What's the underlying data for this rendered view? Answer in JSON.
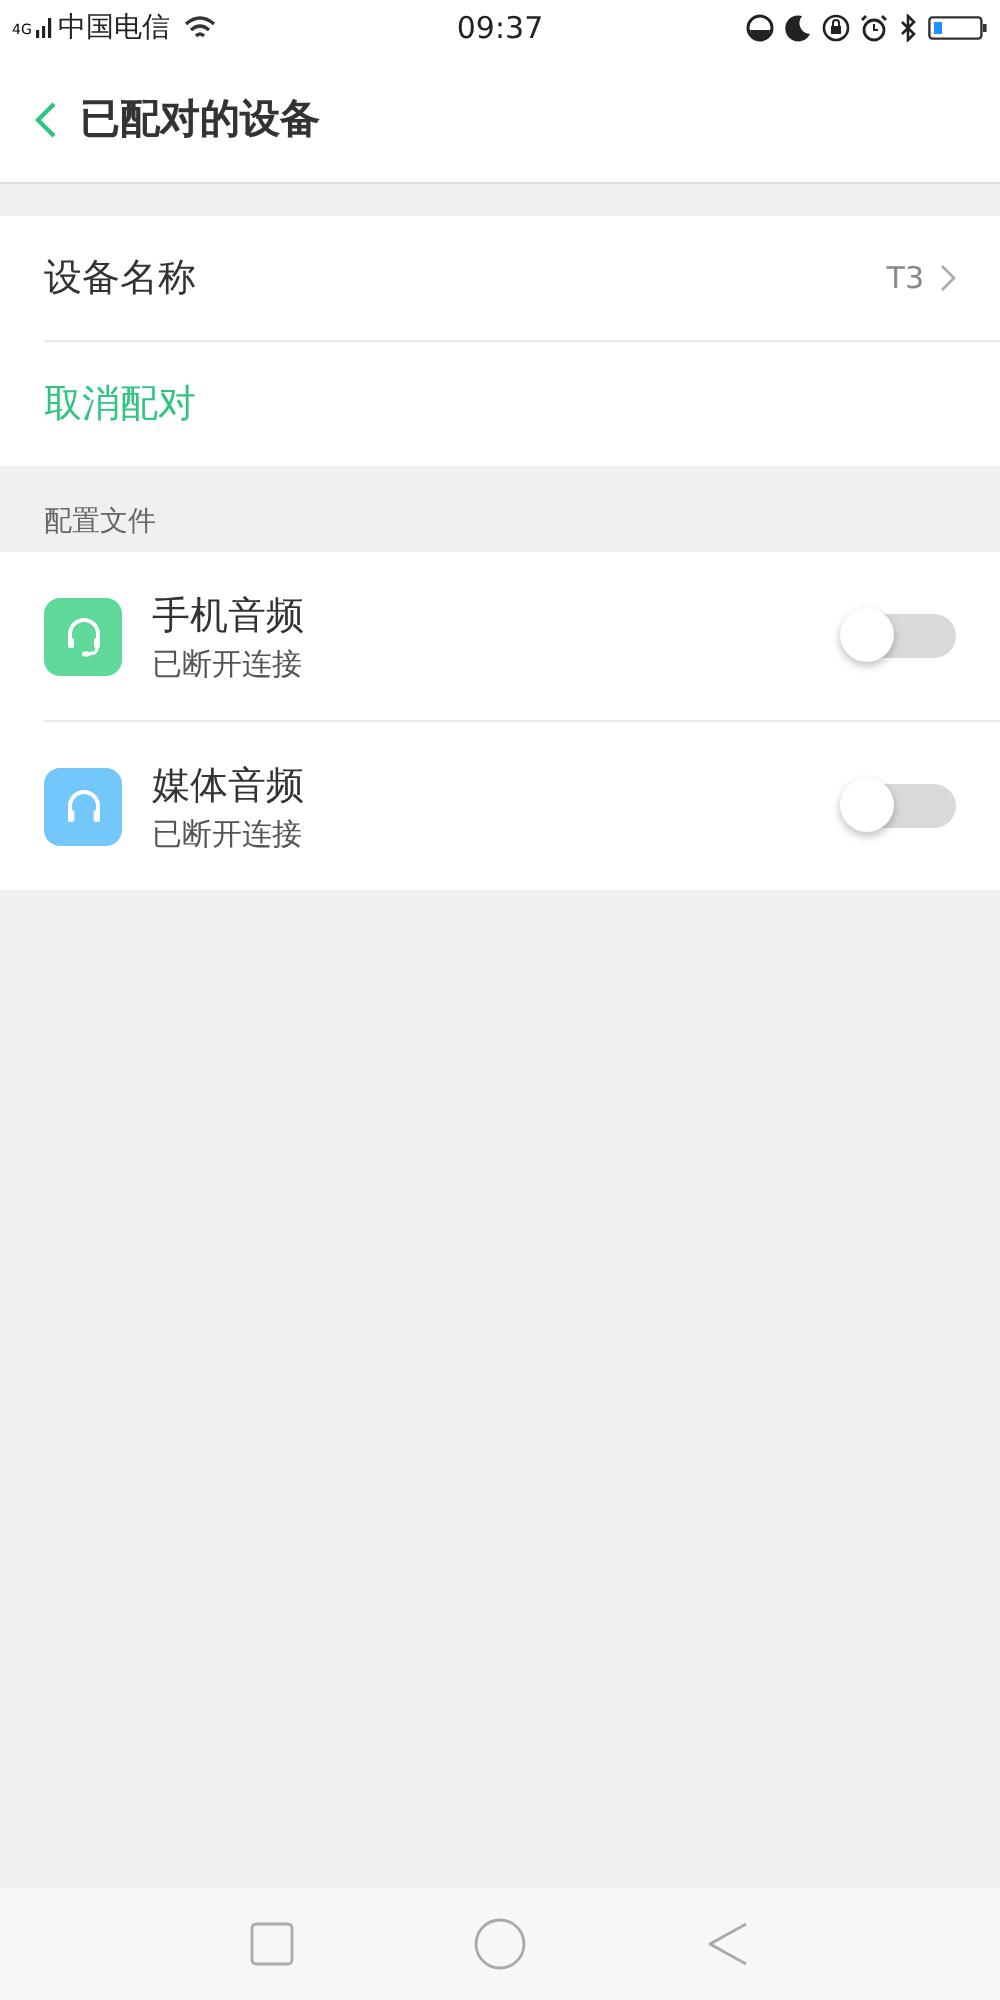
{
  "status_bar": {
    "network": "4G",
    "carrier": "中国电信",
    "time": "09:37"
  },
  "header": {
    "title": "已配对的设备"
  },
  "device_section": {
    "rows": [
      {
        "kind": "value",
        "label": "设备名称",
        "value": "T3"
      },
      {
        "kind": "action",
        "label": "取消配对"
      }
    ]
  },
  "profiles": {
    "heading": "配置文件",
    "items": [
      {
        "kind": "headset",
        "name": "手机音频",
        "status": "已断开连接",
        "color": "#5fd89a",
        "on": false
      },
      {
        "kind": "headphones",
        "name": "媒体音频",
        "status": "已断开连接",
        "color": "#74c7fb",
        "on": false
      }
    ]
  }
}
